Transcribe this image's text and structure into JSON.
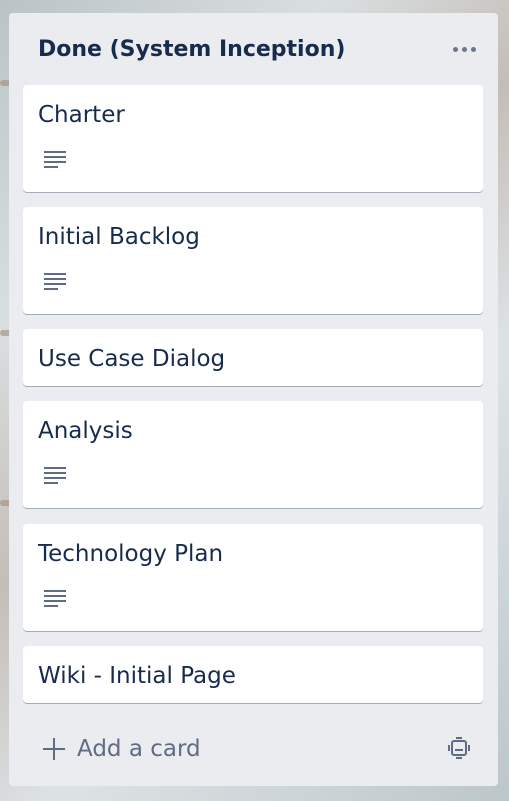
{
  "list": {
    "title": "Done (System Inception)",
    "menu_icon": "more-horizontal-icon",
    "cards": [
      {
        "title": "Charter",
        "has_description": true
      },
      {
        "title": "Initial Backlog",
        "has_description": true
      },
      {
        "title": "Use Case Dialog",
        "has_description": false
      },
      {
        "title": "Analysis",
        "has_description": true
      },
      {
        "title": "Technology Plan",
        "has_description": true
      },
      {
        "title": "Wiki - Initial Page",
        "has_description": false
      }
    ],
    "add_card_label": "Add a card",
    "add_card_icon": "plus-icon",
    "template_icon": "card-template-icon"
  },
  "colors": {
    "list_bg": "#ebecf0",
    "card_bg": "#ffffff",
    "text": "#172b4d",
    "muted": "#5e6c84"
  }
}
